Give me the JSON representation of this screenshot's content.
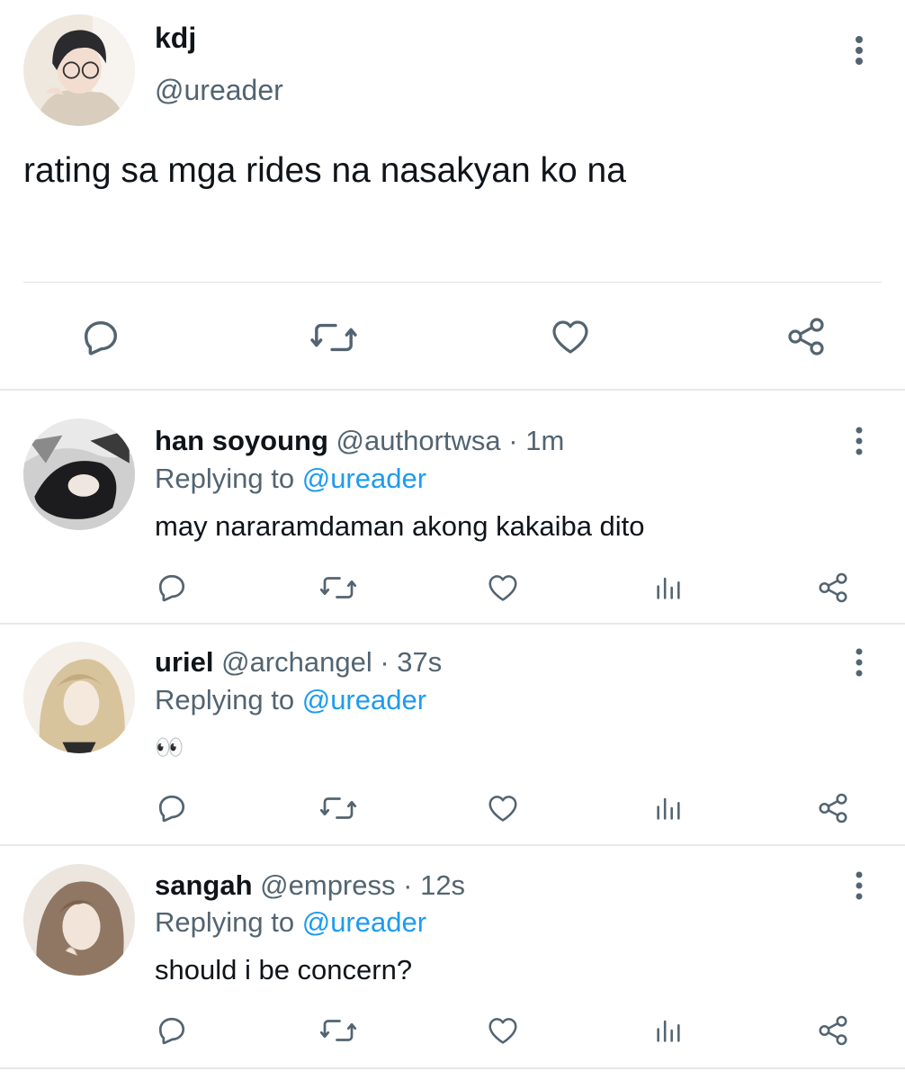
{
  "main_tweet": {
    "name": "kdj",
    "handle": "@ureader",
    "text": "rating sa mga rides na nasakyan ko na",
    "actions": [
      "reply-icon",
      "retweet-icon",
      "like-icon",
      "share-icon"
    ]
  },
  "replies": [
    {
      "name": "han soyoung",
      "handle": "@authortwsa",
      "dot": "·",
      "time": "1m",
      "replying_label": "Replying to",
      "replying_to": "@ureader",
      "text": "may nararamdaman akong kakaiba dito"
    },
    {
      "name": "uriel",
      "handle": "@archangel",
      "dot": "·",
      "time": "37s",
      "replying_label": "Replying to",
      "replying_to": "@ureader",
      "text": "👀"
    },
    {
      "name": "sangah",
      "handle": "@empress",
      "dot": "·",
      "time": "12s",
      "replying_label": "Replying to",
      "replying_to": "@ureader",
      "text": "should i be concern?"
    }
  ],
  "reply_actions": [
    "reply-icon",
    "retweet-icon",
    "like-icon",
    "analytics-icon",
    "share-icon"
  ],
  "colors": {
    "text": "#0f1419",
    "secondary": "#536471",
    "link": "#1d9bf0",
    "divider": "#dfe3e6"
  }
}
